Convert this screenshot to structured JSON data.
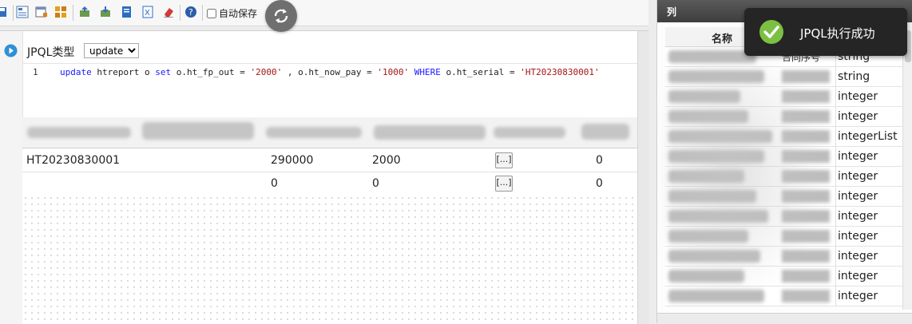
{
  "toolbar": {
    "autosave_label": "自动保存",
    "icons": [
      "save-icon",
      "grid-view-icon",
      "table-icon",
      "layout-icon",
      "import-icon",
      "export-icon",
      "document-icon",
      "excel-icon",
      "eraser-icon",
      "help-icon",
      "refresh-icon"
    ]
  },
  "query": {
    "type_label": "JPQL类型",
    "type_value": "update",
    "line_number": "1",
    "code_parts": {
      "kw1": "update",
      "t1": " htreport o ",
      "kw2": "set",
      "t2": " o.ht_fp_out = ",
      "s1": "'2000'",
      "t3": " , o.ht_now_pay = ",
      "s2": "'1000'",
      "t4": " ",
      "kw3": "WHERE",
      "t5": " o.ht_serial = ",
      "s3": "'HT20230830001'"
    }
  },
  "results": {
    "rows": [
      {
        "serial": "HT20230830001",
        "c2": "290000",
        "c3": "2000",
        "action": "[...]",
        "c5": "0"
      },
      {
        "serial": "",
        "c2": "0",
        "c3": "0",
        "action": "[...]",
        "c5": "0"
      }
    ]
  },
  "columns_panel": {
    "title": "列",
    "header_name": "名称",
    "header_serial": "合同序号",
    "types": [
      "string",
      "string",
      "integer",
      "integer",
      "integerList",
      "integer",
      "integer",
      "integer",
      "integer",
      "integer",
      "integer",
      "integer",
      "integer"
    ]
  },
  "toast": {
    "message": "JPQL执行成功"
  }
}
